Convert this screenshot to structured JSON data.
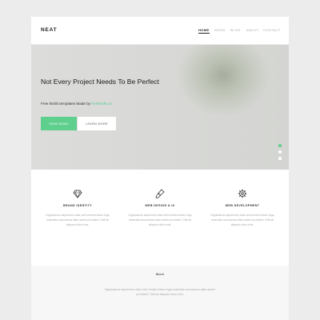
{
  "header": {
    "logo": "NEAT",
    "nav": [
      {
        "label": "HOME",
        "active": true
      },
      {
        "label": "WORK",
        "active": false
      },
      {
        "label": "BLOG",
        "active": false
      },
      {
        "label": "ABOUT",
        "active": false
      },
      {
        "label": "CONTACT",
        "active": false
      }
    ]
  },
  "hero": {
    "title": "Not Every Project Needs To Be Perfect",
    "subtitle_prefix": "Free html5 templates Made by ",
    "subtitle_link": "freehtml5.co",
    "primary_button": "VIEW DEMO",
    "secondary_button": "LEARN MORE",
    "slides": 3,
    "active_slide": 0
  },
  "services": [
    {
      "icon": "diamond-icon",
      "title": "BRAND IDENTITY",
      "description": "Dignissimos asperiores vitae velit veniam totam fuga molestias accusamus alias autem provident. Odit ab aliquam dolor eius."
    },
    {
      "icon": "paintbrush-icon",
      "title": "WEB DESIGN & UI",
      "description": "Dignissimos asperiores vitae velit veniam totam fuga molestias accusamus alias autem provident. Odit ab aliquam dolor eius."
    },
    {
      "icon": "gear-icon",
      "title": "WEB DEVELOPMENT",
      "description": "Dignissimos asperiores vitae velit veniam totam fuga molestias accusamus alias autem provident. Odit ab aliquam dolor eius."
    }
  ],
  "work": {
    "title": "Work",
    "description": "Dignissimos asperiores vitae velit veniam totam fuga molestias accusamus alias autem provident. Odit ab aliquam dolor eius."
  },
  "colors": {
    "accent": "#5fcf8d",
    "background": "#ececec"
  }
}
